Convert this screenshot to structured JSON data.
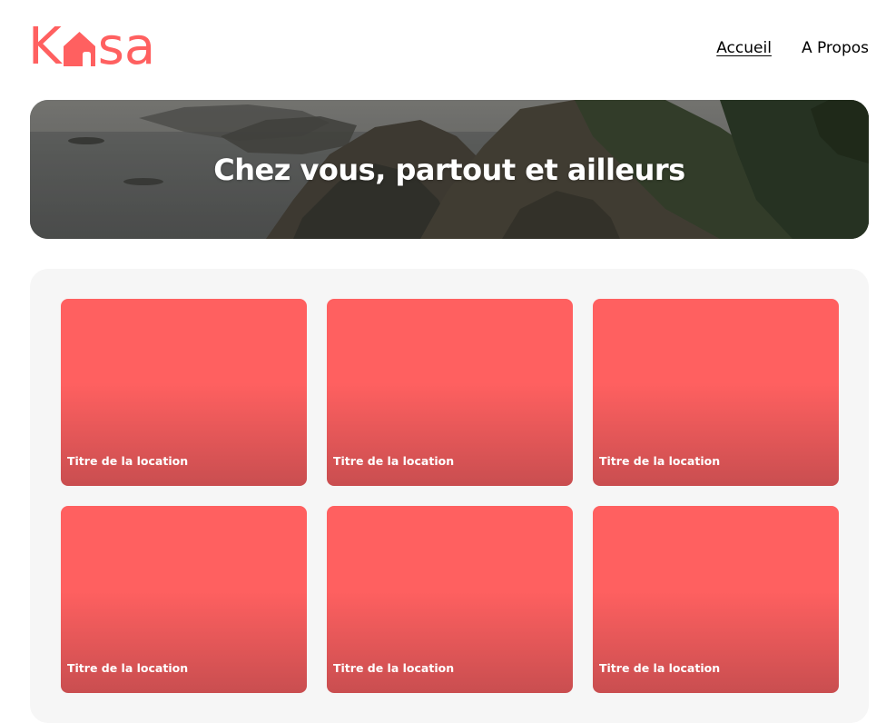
{
  "brand": {
    "logo_prefix": "K",
    "logo_suffix": "sa",
    "logo_icon": "house-icon",
    "accent_color": "#FF6060"
  },
  "nav": {
    "items": [
      {
        "label": "Accueil",
        "active": true
      },
      {
        "label": "A Propos",
        "active": false
      }
    ]
  },
  "banner": {
    "title": "Chez vous, partout et ailleurs"
  },
  "gallery": {
    "cards": [
      {
        "title": "Titre de la location"
      },
      {
        "title": "Titre de la location"
      },
      {
        "title": "Titre de la location"
      },
      {
        "title": "Titre de la location"
      },
      {
        "title": "Titre de la location"
      },
      {
        "title": "Titre de la location"
      }
    ]
  },
  "colors": {
    "card_top": "#FF6060",
    "card_bottom": "#C94E50",
    "gallery_background": "#F6F6F6"
  }
}
